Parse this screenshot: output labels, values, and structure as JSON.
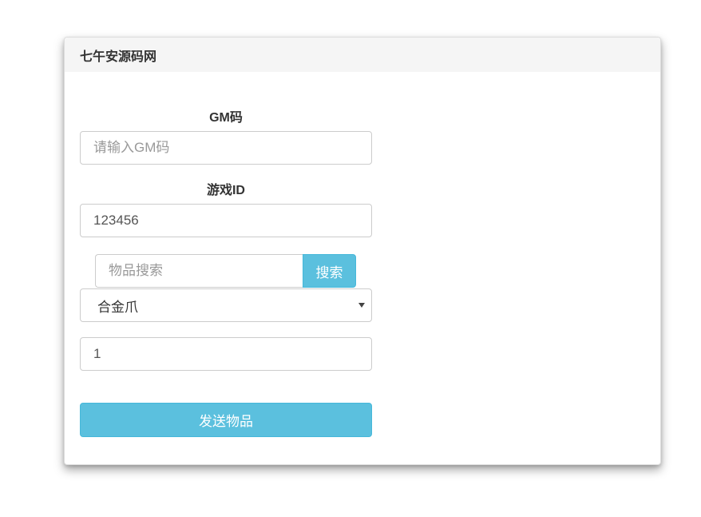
{
  "panel": {
    "title": "七午安源码网"
  },
  "form": {
    "gm_code": {
      "label": "GM码",
      "placeholder": "请输入GM码",
      "value": ""
    },
    "game_id": {
      "label": "游戏ID",
      "value": "123456"
    },
    "item_search": {
      "placeholder": "物品搜索",
      "value": "",
      "button_label": "搜索"
    },
    "item_select": {
      "selected": "合金爪"
    },
    "quantity": {
      "value": "1"
    },
    "send_button_label": "发送物品"
  },
  "colors": {
    "accent": "#5bc0de",
    "heading_bg": "#f5f5f5"
  }
}
